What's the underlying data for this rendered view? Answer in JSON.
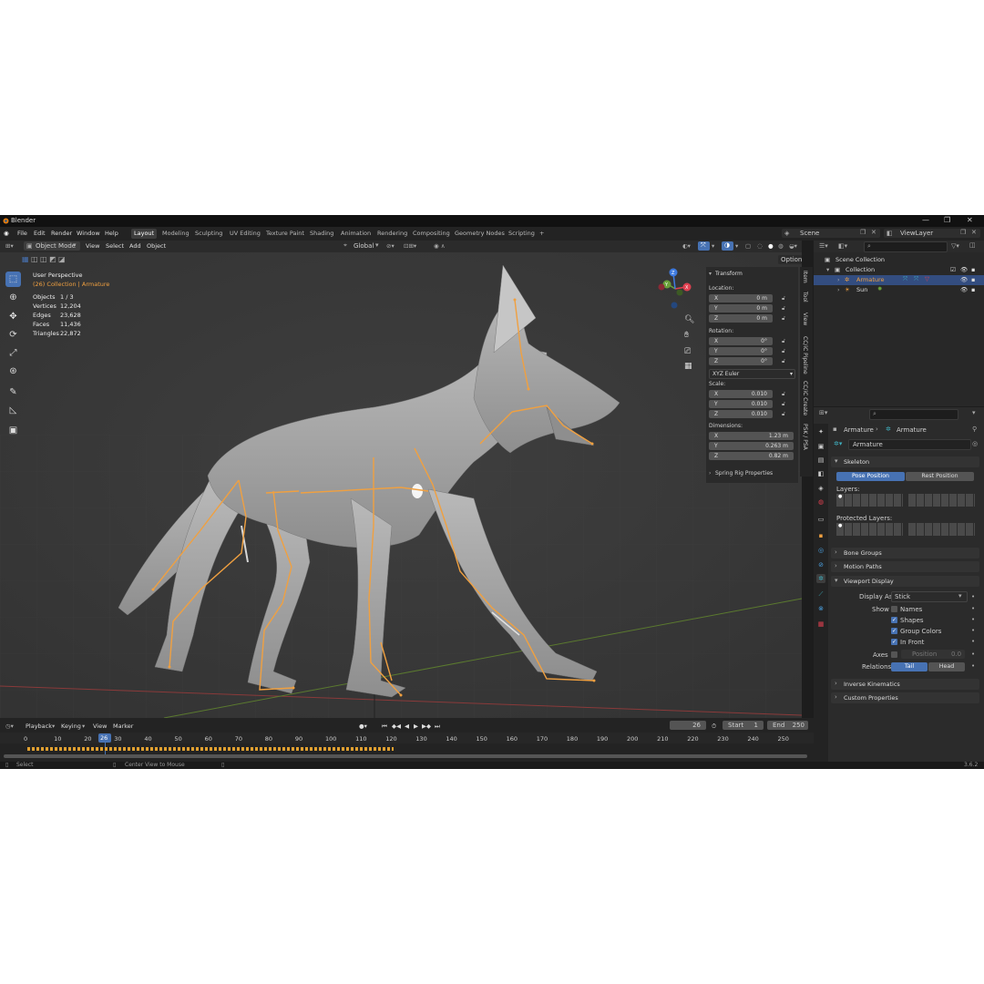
{
  "app": {
    "title": "Blender",
    "version": "3.6.2"
  },
  "window_controls": [
    "—",
    "❐",
    "✕"
  ],
  "menu": [
    "File",
    "Edit",
    "Render",
    "Window",
    "Help"
  ],
  "workspaces": [
    "Layout",
    "Modeling",
    "Sculpting",
    "UV Editing",
    "Texture Paint",
    "Shading",
    "Animation",
    "Rendering",
    "Compositing",
    "Geometry Nodes",
    "Scripting",
    "+"
  ],
  "active_workspace": "Layout",
  "scene": {
    "name": "Scene",
    "view_layer": "ViewLayer"
  },
  "viewport_header": {
    "mode": "Object Mode",
    "menus": [
      "View",
      "Select",
      "Add",
      "Object"
    ],
    "orientation": "Global",
    "options": "Options"
  },
  "viewport_overlay": {
    "perspective": "User Perspective",
    "collection": "(26) Collection | Armature",
    "stats": [
      {
        "label": "Objects",
        "value": "1 / 3"
      },
      {
        "label": "Vertices",
        "value": "12,204"
      },
      {
        "label": "Edges",
        "value": "23,628"
      },
      {
        "label": "Faces",
        "value": "11,436"
      },
      {
        "label": "Triangles",
        "value": "22,872"
      }
    ]
  },
  "gizmo_axes": [
    "X",
    "Y",
    "Z"
  ],
  "npanel": {
    "title": "Transform",
    "location_label": "Location:",
    "location": [
      {
        "axis": "X",
        "value": "0 m"
      },
      {
        "axis": "Y",
        "value": "0 m"
      },
      {
        "axis": "Z",
        "value": "0 m"
      }
    ],
    "rotation_label": "Rotation:",
    "rotation": [
      {
        "axis": "X",
        "value": "0°"
      },
      {
        "axis": "Y",
        "value": "0°"
      },
      {
        "axis": "Z",
        "value": "0°"
      }
    ],
    "rotation_mode": "XYZ Euler",
    "scale_label": "Scale:",
    "scale": [
      {
        "axis": "X",
        "value": "0.010"
      },
      {
        "axis": "Y",
        "value": "0.010"
      },
      {
        "axis": "Z",
        "value": "0.010"
      }
    ],
    "dimensions_label": "Dimensions:",
    "dimensions": [
      {
        "axis": "X",
        "value": "1.23 m"
      },
      {
        "axis": "Y",
        "value": "0.263 m"
      },
      {
        "axis": "Z",
        "value": "0.82 m"
      }
    ],
    "spring": "Spring Rig Properties"
  },
  "side_tabs": [
    "Item",
    "Tool",
    "View",
    "CC/iC Pipeline",
    "CC/iC Create",
    "PSK / PSA"
  ],
  "outliner": {
    "root": "Scene Collection",
    "items": [
      {
        "name": "Collection",
        "indent": 1
      },
      {
        "name": "Armature",
        "indent": 2,
        "selected": true
      },
      {
        "name": "Sun",
        "indent": 2
      }
    ]
  },
  "properties": {
    "breadcrumb_a": "Armature",
    "breadcrumb_b": "Armature",
    "datablock": "Armature",
    "skeleton": "Skeleton",
    "pose_position": "Pose Position",
    "rest_position": "Rest Position",
    "layers": "Layers:",
    "protected_layers": "Protected Layers:",
    "bone_groups": "Bone Groups",
    "motion_paths": "Motion Paths",
    "viewport_display": "Viewport Display",
    "display_as_label": "Display As",
    "display_as_value": "Stick",
    "show_label": "Show",
    "show_options": [
      {
        "label": "Names",
        "checked": false
      },
      {
        "label": "Shapes",
        "checked": true
      },
      {
        "label": "Group Colors",
        "checked": true
      },
      {
        "label": "In Front",
        "checked": true
      }
    ],
    "axes_label": "Axes",
    "axes_position_label": "Position",
    "axes_position_value": "0.0",
    "relations_label": "Relations",
    "relations_tail": "Tail",
    "relations_head": "Head",
    "inverse_kinematics": "Inverse Kinematics",
    "custom_properties": "Custom Properties"
  },
  "timeline": {
    "menus": [
      "Playback",
      "Keying",
      "View",
      "Marker"
    ],
    "current_frame": "26",
    "start_label": "Start",
    "start": "1",
    "end_label": "End",
    "end": "250",
    "ruler": [
      "0",
      "10",
      "20",
      "30",
      "40",
      "50",
      "60",
      "70",
      "80",
      "90",
      "100",
      "110",
      "120",
      "130",
      "140",
      "150",
      "160",
      "170",
      "180",
      "190",
      "200",
      "210",
      "220",
      "230",
      "240",
      "250"
    ]
  },
  "statusbar": {
    "left": "Select",
    "middle": "Center View to Mouse"
  }
}
